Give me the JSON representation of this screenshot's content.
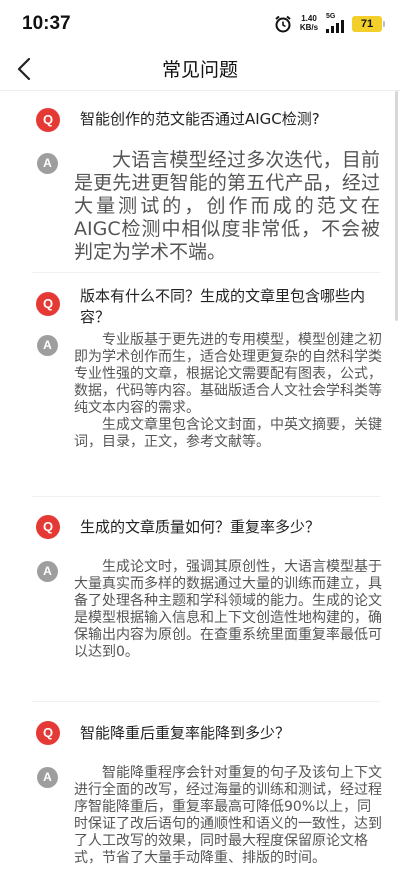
{
  "status_bar": {
    "time": "10:37",
    "net_speed_value": "1.40",
    "net_speed_unit": "KB/s",
    "signal_label": "5G",
    "battery": "71"
  },
  "nav": {
    "title": "常见问题"
  },
  "faqs": [
    {
      "q_badge": "Q",
      "a_badge": "A",
      "question": "智能创作的范文能否通过AIGC检测?",
      "answer": [
        "大语言模型经过多次迭代，目前是更先进更智能的第五代产品，经过大量测试的，创作而成的范文在AIGC检测中相似度非常低，不会被判定为学术不端。"
      ]
    },
    {
      "q_badge": "Q",
      "a_badge": "A",
      "question": "版本有什么不同？生成的文章里包含哪些内容？",
      "answer": [
        "专业版基于更先进的专用模型，模型创建之初即为学术创作而生，适合处理更复杂的自然科学类专业性强的文章，根据论文需要配有图表，公式，数据，代码等内容。基础版适合人文社会学科类等纯文本内容的需求。",
        "生成文章里包含论文封面，中英文摘要，关键词，目录，正文，参考文献等。"
      ]
    },
    {
      "q_badge": "Q",
      "a_badge": "A",
      "question": "生成的文章质量如何？重复率多少？",
      "answer": [
        "生成论文时，强调其原创性，大语言模型基于大量真实而多样的数据通过大量的训练而建立，具备了处理各种主题和学科领域的能力。生成的论文是模型根据输入信息和上下文创造性地构建的，确保输出内容为原创。在查重系统里面重复率最低可以达到0。"
      ]
    },
    {
      "q_badge": "Q",
      "a_badge": "A",
      "question": "智能降重后重复率能降到多少？",
      "answer": [
        "智能降重程序会针对重复的句子及该句上下文进行全面的改写，经过海量的训练和测试，经过程序智能降重后，重复率最高可降低90%以上，同时保证了改后语句的通顺性和语义的一致性，达到了人工改写的效果，同时最大程度保留原论文格式，节省了大量手动降重、排版的时间。"
      ]
    }
  ]
}
